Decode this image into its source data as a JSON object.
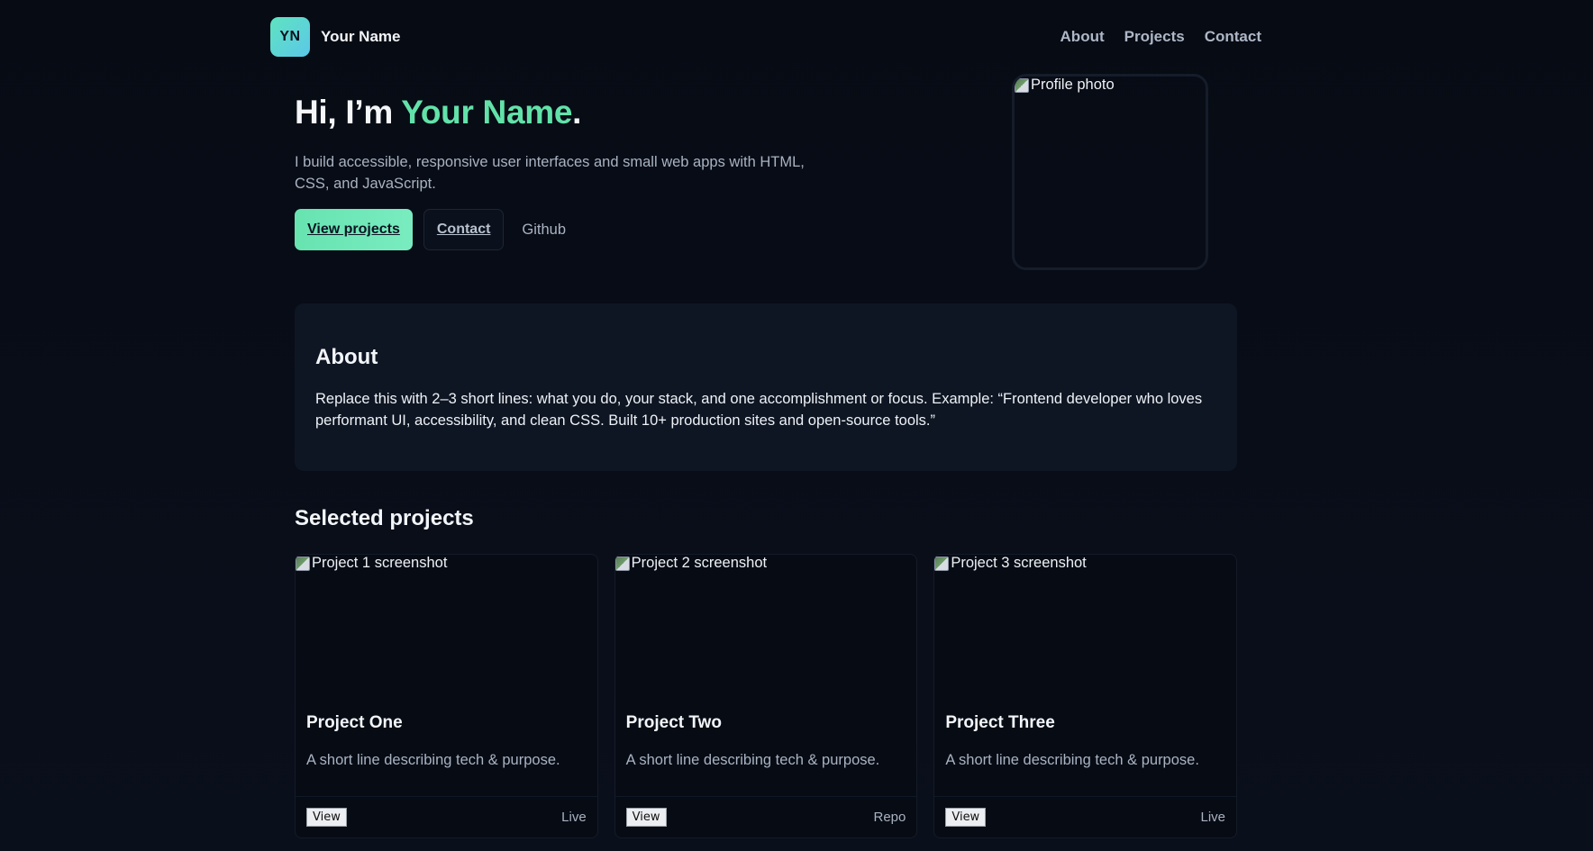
{
  "header": {
    "logo_text": "YN",
    "brand_name": "Your Name",
    "nav": [
      "About",
      "Projects",
      "Contact"
    ]
  },
  "hero": {
    "greeting": "Hi, I’m ",
    "name": "Your Name",
    "period": ".",
    "subtitle": "I build accessible, responsive user interfaces and small web apps with HTML, CSS, and JavaScript.",
    "primary_button": "View projects",
    "secondary_button": "Contact",
    "github_link": "Github",
    "photo_alt": "Profile photo"
  },
  "about": {
    "title": "About",
    "text": "Replace this with 2–3 short lines: what you do, your stack, and one accomplishment or focus. Example: “Frontend developer who loves performant UI, accessibility, and clean CSS. Built 10+ production sites and open-source tools.”"
  },
  "projects": {
    "title": "Selected projects",
    "items": [
      {
        "alt": "Project 1 screenshot",
        "name": "Project One",
        "desc": "A short line describing tech & purpose.",
        "button": "View",
        "link": "Live"
      },
      {
        "alt": "Project 2 screenshot",
        "name": "Project Two",
        "desc": "A short line describing tech & purpose.",
        "button": "View",
        "link": "Repo"
      },
      {
        "alt": "Project 3 screenshot",
        "name": "Project Three",
        "desc": "A short line describing tech & purpose.",
        "button": "View",
        "link": "Live"
      }
    ]
  },
  "colors": {
    "background": "#080c16",
    "accent": "#62e2a9",
    "panel": "#0f1623"
  }
}
